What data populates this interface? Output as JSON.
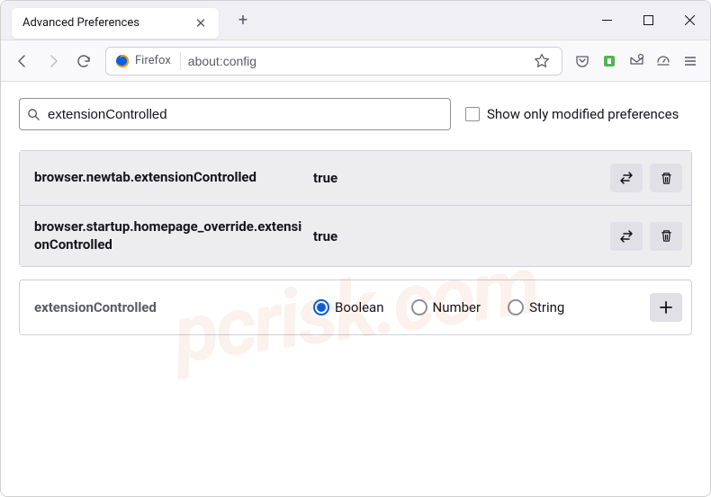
{
  "window": {
    "tab_title": "Advanced Preferences"
  },
  "toolbar": {
    "identity_label": "Firefox",
    "url": "about:config"
  },
  "search": {
    "value": "extensionControlled",
    "checkbox_label": "Show only modified preferences"
  },
  "prefs": [
    {
      "name": "browser.newtab.extensionControlled",
      "value": "true"
    },
    {
      "name": "browser.startup.homepage_override.extensionControlled",
      "value": "true"
    }
  ],
  "new_pref": {
    "name": "extensionControlled",
    "types": [
      "Boolean",
      "Number",
      "String"
    ],
    "selected": "Boolean"
  },
  "watermark": "pcrisk.com"
}
